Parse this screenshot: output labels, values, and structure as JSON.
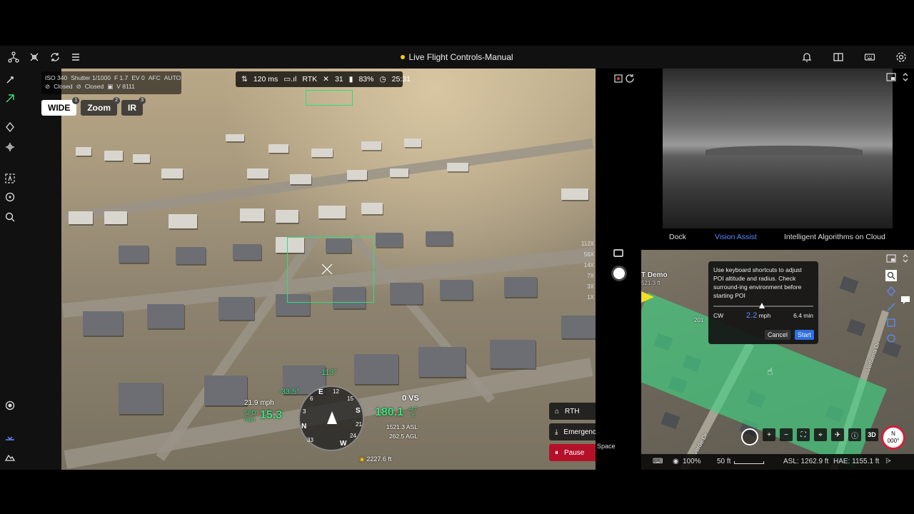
{
  "window": {
    "title": "Live Flight Controls-Manual"
  },
  "topbar": {
    "left_icons": [
      "topology-icon",
      "drone-icon",
      "sync-icon",
      "layers-icon"
    ],
    "right_icons": [
      "bell-icon",
      "split-view-icon",
      "keyboard-icon",
      "settings-icon"
    ]
  },
  "camera": {
    "iso": "ISO 340",
    "shutter": "Shutter 1/1000",
    "aperture": "F 1.7",
    "ev": "EV 0",
    "focus": "AFC",
    "mode": "AUTO",
    "lock1": "Closed",
    "lock2": "Closed",
    "storage": "V 8111"
  },
  "lens_tabs": [
    {
      "label": "WIDE",
      "num": "1",
      "active": true
    },
    {
      "label": "Zoom",
      "num": "2",
      "active": false
    },
    {
      "label": "IR",
      "num": "3",
      "active": false
    }
  ],
  "status": {
    "latency": "120 ms",
    "rtk_label": "RTK",
    "satellites": "31",
    "battery": "83%",
    "flight_time": "25:31"
  },
  "zoom_levels": [
    "112X",
    "56X",
    "14X",
    "7X",
    "3X",
    "1X"
  ],
  "flight": {
    "heading": "113°",
    "pitch": "-33.5°",
    "wind_speed": "21.9 mph",
    "spd_label": "SPD",
    "spd_unit": "mph",
    "speed": "15.3",
    "vs": "0 VS",
    "alt": "180.1",
    "alt_label": "ALT",
    "alt_unit": "ft",
    "asl": "1521.3 ASL",
    "agl": "262.5 AGL",
    "distance": "2227.6 ft",
    "compass_labels": {
      "n": "N",
      "e": "E",
      "s": "S",
      "w": "W",
      "n12": "12",
      "n15": "15",
      "n21": "21",
      "n24": "24",
      "n3": "3",
      "n33": "33",
      "n6": "6"
    }
  },
  "actions": [
    {
      "label": "RTH",
      "icon": "rth-icon"
    },
    {
      "label": "Emergency Lan...",
      "icon": "emergency-landing-icon"
    },
    {
      "label": "Pause",
      "icon": "pause-icon"
    }
  ],
  "space_hint": "Space",
  "ir_tabs": [
    "Dock",
    "Vision Assist",
    "Intelligent Algorithms on Cloud"
  ],
  "poi_dialog": {
    "message": "Use keyboard shortcuts to adjust POI altitude and radius. Check surround-ing environment before starting POI",
    "direction": "CW",
    "speed": "2.2",
    "speed_unit": "mph",
    "duration": "6.4 min",
    "cancel": "Cancel",
    "start": "Start"
  },
  "map": {
    "marker_label": "T Demo",
    "marker_sub": "521.3 ft",
    "road_label_1": "Verbena Dr",
    "road_label_2": "o Verde Dr",
    "zone_label": "201",
    "opacity": "100%",
    "scale": "50 ft",
    "asl": "ASL: 1262.9 ft",
    "hae": "HAE: 1155.1 ft",
    "compass_n": "N",
    "compass_deg": "000°",
    "view_3d": "3D"
  },
  "colors": {
    "accent_blue": "#5b8cff",
    "hud_green": "#3ee07b",
    "pause_red": "#b5102a",
    "status_dot": "#f5c518"
  }
}
